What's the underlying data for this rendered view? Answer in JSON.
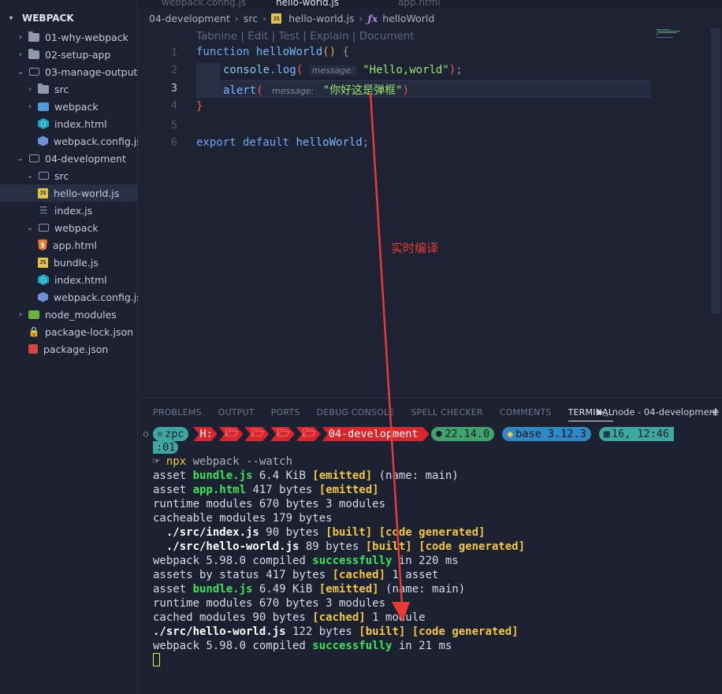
{
  "sidebar": {
    "title": "WEBPACK",
    "items": [
      {
        "label": "01-why-webpack",
        "type": "folder"
      },
      {
        "label": "02-setup-app",
        "type": "folder"
      },
      {
        "label": "03-manage-output",
        "type": "folder-open"
      },
      {
        "label": "src",
        "type": "folder"
      },
      {
        "label": "webpack",
        "type": "folder"
      },
      {
        "label": "index.html",
        "type": "html"
      },
      {
        "label": "webpack.config.js",
        "type": "config"
      },
      {
        "label": "04-development",
        "type": "folder-open"
      },
      {
        "label": "src",
        "type": "folder-open"
      },
      {
        "label": "hello-world.js",
        "type": "js"
      },
      {
        "label": "index.js",
        "type": "index"
      },
      {
        "label": "webpack",
        "type": "folder-open"
      },
      {
        "label": "app.html",
        "type": "html5"
      },
      {
        "label": "bundle.js",
        "type": "js"
      },
      {
        "label": "index.html",
        "type": "html"
      },
      {
        "label": "webpack.config.js",
        "type": "config"
      },
      {
        "label": "node_modules",
        "type": "folder"
      },
      {
        "label": "package-lock.json",
        "type": "lock"
      },
      {
        "label": "package.json",
        "type": "package"
      }
    ]
  },
  "tabs": [
    {
      "label": "webpack.config.js"
    },
    {
      "label": "hello-world.js"
    },
    {
      "label": "app.html"
    }
  ],
  "breadcrumb": {
    "folder": "04-development",
    "sub": "src",
    "file": "hello-world.js",
    "symbol": "helloWorld"
  },
  "codelens": "Tabnine | Edit | Test | Explain | Document",
  "code": {
    "line_numbers": [
      "1",
      "2",
      "3",
      "4",
      "5",
      "6"
    ],
    "l1_kw": "function",
    "l1_fn": "helloWorld",
    "l1_rest": "() {",
    "l2_obj": "console",
    "l2_method": "log",
    "l2_hint": "message:",
    "l2_str": "\"Hello,world\"",
    "l3_method": "alert",
    "l3_hint": "message:",
    "l3_str": "\"你好这是弹框\"",
    "l4": "}",
    "l6_kw": "export default",
    "l6_fn": "helloWorld"
  },
  "annotation": "实时编译",
  "panel": {
    "tabs": [
      "PROBLEMS",
      "OUTPUT",
      "PORTS",
      "DEBUG CONSOLE",
      "SPELL CHECKER",
      "COMMENTS",
      "TERMINAL"
    ],
    "terminal_name": "node - 04-development",
    "plus": "+"
  },
  "prompt": {
    "user": "zpc",
    "drive": "H:",
    "path": "04-development",
    "node": "22.14.0",
    "python": "base 3.12.3",
    "time": "16, 12:46",
    "time_cont": ":01"
  },
  "terminal": {
    "command": "npx webpack --watch",
    "lines": [
      {
        "a": "asset ",
        "b": "bundle.js",
        "c": " 6.4 KiB ",
        "d": "[emitted]",
        "e": " (name: main)"
      },
      {
        "a": "asset ",
        "b": "app.html",
        "c": " 417 bytes ",
        "d": "[emitted]",
        "e": ""
      },
      {
        "a": "runtime modules 670 bytes 3 modules"
      },
      {
        "a": "cacheable modules 179 bytes"
      },
      {
        "a": "  ./src/index.js",
        "c": " 90 bytes ",
        "d": "[built] [code generated]"
      },
      {
        "a": "  ./src/hello-world.js",
        "c": " 89 bytes ",
        "d": "[built] [code generated]"
      },
      {
        "a": "webpack 5.98.0 compiled ",
        "g": "successfully",
        "e": " in 220 ms"
      },
      {
        "a": "assets by status 417 bytes ",
        "d": "[cached]",
        "e": " 1 asset"
      },
      {
        "a": "asset ",
        "b": "bundle.js",
        "c": " 6.49 KiB ",
        "d": "[emitted]",
        "e": " (name: main)"
      },
      {
        "a": "runtime modules 670 bytes 3 modules"
      },
      {
        "a": "cached modules 90 bytes ",
        "d": "[cached]",
        "e": " 1 module"
      },
      {
        "a": "./src/hello-world.js",
        "c": " 122 bytes ",
        "d": "[built] [code generated]"
      },
      {
        "a": "webpack 5.98.0 compiled ",
        "g": "successfully",
        "e": " in 21 ms"
      }
    ]
  },
  "colors": {
    "accent_red": "#e53b34",
    "success_green": "#3ce35a",
    "status_yellow": "#f2c744"
  }
}
